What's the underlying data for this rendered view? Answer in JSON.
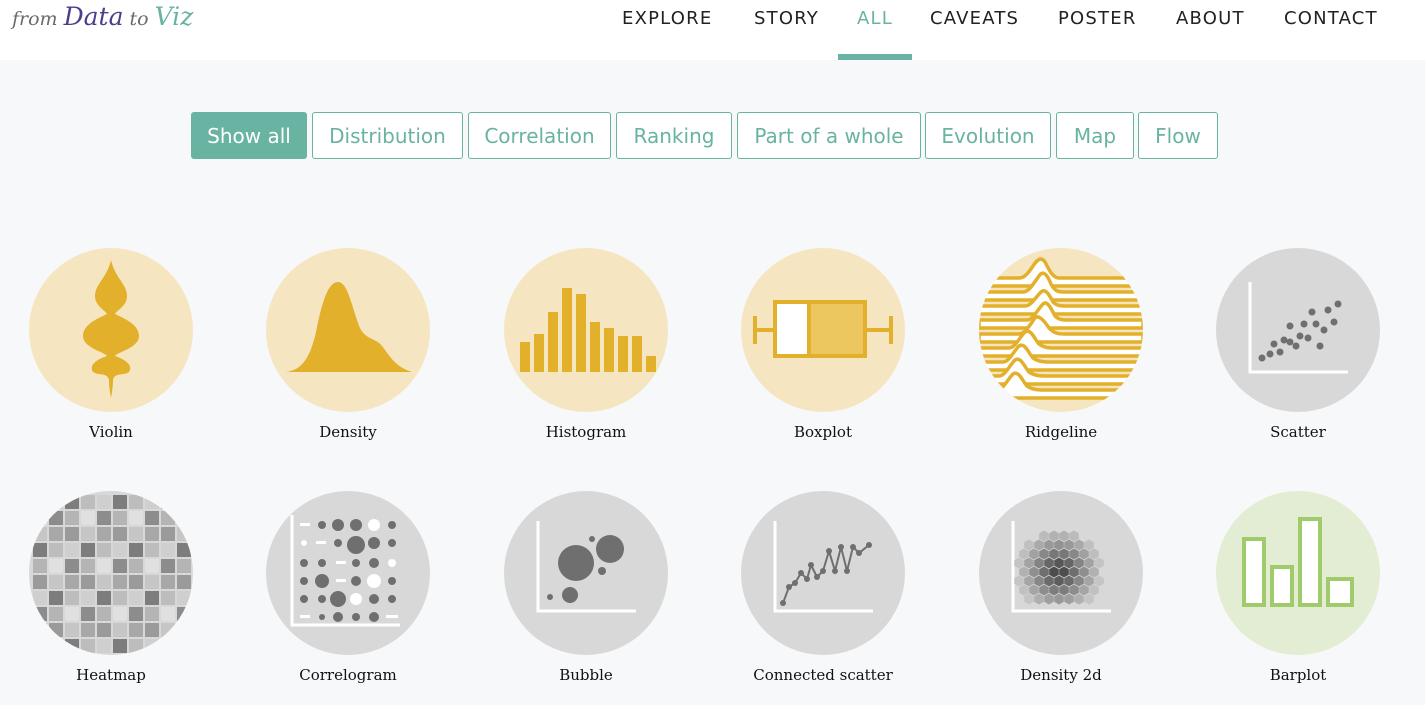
{
  "logo": {
    "w1": "from",
    "w2": "Data",
    "w3": "to",
    "w4": "Viz"
  },
  "nav": [
    "EXPLORE",
    "STORY",
    "ALL",
    "CAVEATS",
    "POSTER",
    "ABOUT",
    "CONTACT"
  ],
  "nav_active": "ALL",
  "filters": [
    "Show all",
    "Distribution",
    "Correlation",
    "Ranking",
    "Part of a whole",
    "Evolution",
    "Map",
    "Flow"
  ],
  "filter_active": "Show all",
  "charts": [
    {
      "label": "Violin",
      "icon": "violin-icon",
      "bg": "#f6e5c1"
    },
    {
      "label": "Density",
      "icon": "density-icon",
      "bg": "#f6e5c1"
    },
    {
      "label": "Histogram",
      "icon": "histogram-icon",
      "bg": "#f6e5c1"
    },
    {
      "label": "Boxplot",
      "icon": "boxplot-icon",
      "bg": "#f6e5c1"
    },
    {
      "label": "Ridgeline",
      "icon": "ridgeline-icon",
      "bg": "#f6e5c1"
    },
    {
      "label": "Scatter",
      "icon": "scatter-icon",
      "bg": "#d8d8d8"
    },
    {
      "label": "Heatmap",
      "icon": "heatmap-icon",
      "bg": "#d8d8d8"
    },
    {
      "label": "Correlogram",
      "icon": "correlogram-icon",
      "bg": "#d8d8d8"
    },
    {
      "label": "Bubble",
      "icon": "bubble-icon",
      "bg": "#d8d8d8"
    },
    {
      "label": "Connected scatter",
      "icon": "connected-scatter-icon",
      "bg": "#d8d8d8"
    },
    {
      "label": "Density 2d",
      "icon": "density-2d-icon",
      "bg": "#d8d8d8"
    },
    {
      "label": "Barplot",
      "icon": "barplot-icon",
      "bg": "#e3edd4"
    }
  ],
  "colors": {
    "accent": "#69b3a2",
    "gold": "#e2b02a",
    "gold_light": "#f6e5c1",
    "gray": "#d8d8d8",
    "gray_dark": "#6f6f6f",
    "green": "#9fcb6b",
    "green_light": "#e3edd4"
  }
}
